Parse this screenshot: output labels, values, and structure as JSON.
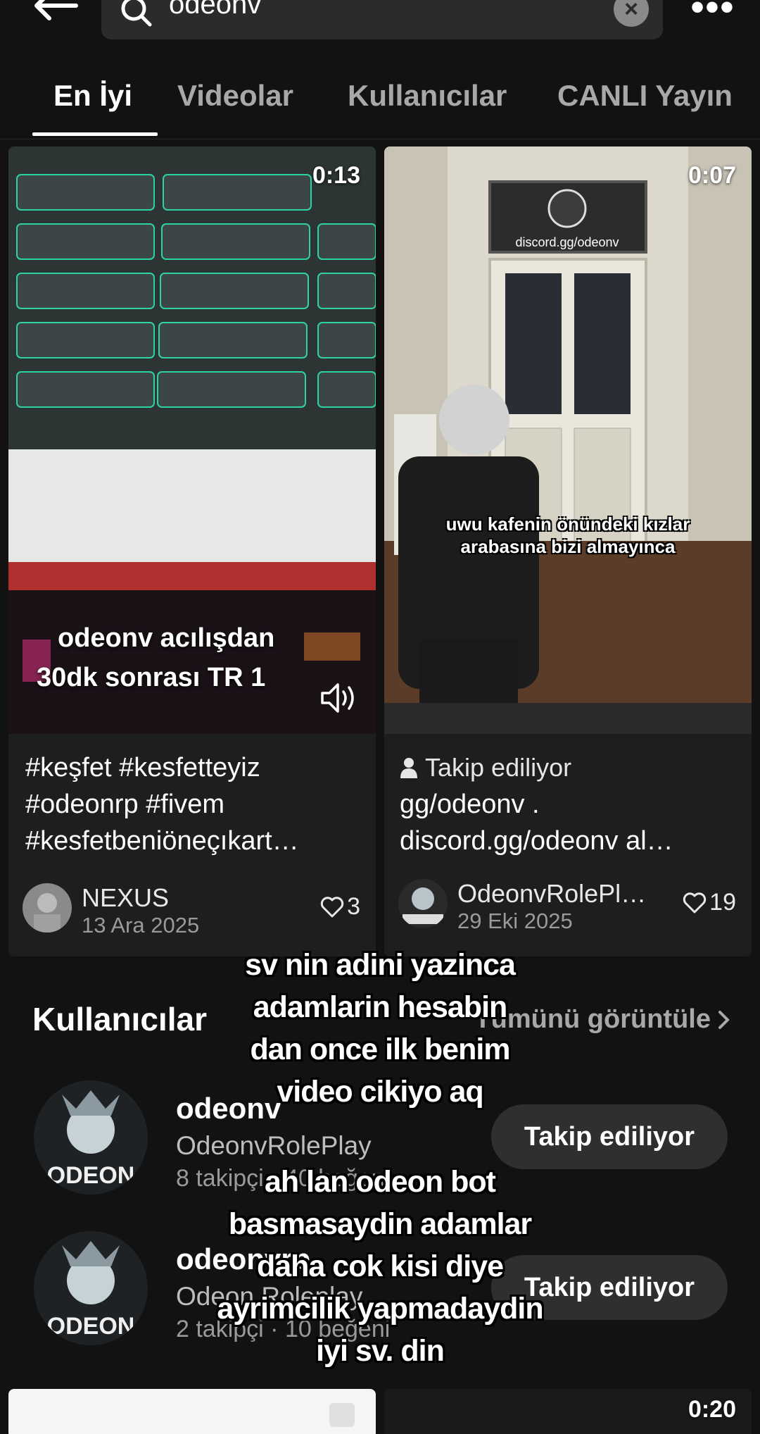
{
  "search": {
    "query": "odeonv",
    "clear_label": "×",
    "more_label": "•••"
  },
  "tabs": [
    {
      "label": "En İyi",
      "active": true
    },
    {
      "label": "Videolar",
      "active": false
    },
    {
      "label": "Kullanıcılar",
      "active": false
    },
    {
      "label": "CANLI Yayın",
      "active": false
    }
  ],
  "videos": [
    {
      "duration": "0:13",
      "overlay_text_1": "odeonv acılışdan",
      "overlay_text_2": "30dk sonrası TR 1",
      "caption_lines": [
        "#keşfet #kesfetteyiz",
        "#odeonrp #fivem",
        "#kesfetbeniöneçıkart…"
      ],
      "author": "NEXUS",
      "date": "13 Ara 2025",
      "likes": "3"
    },
    {
      "duration": "0:07",
      "door_sign": "discord.gg/odeonv",
      "subtitle_1": "uwu kafenin önündeki kızlar",
      "subtitle_2": "arabasına bizi almayınca",
      "following_tag": "Takip ediliyor",
      "caption_lines": [
        "gg/odeonv .",
        "discord.gg/odeonv al…"
      ],
      "author": "OdeonvRolePl…",
      "date": "29 Eki 2025",
      "likes": "19"
    }
  ],
  "users_section": {
    "title": "Kullanıcılar",
    "view_all": "Tümünü görüntüle",
    "users": [
      {
        "handle": "odeonv",
        "name": "OdeonvRolePlay",
        "stats": "8 takipçi · 40 beğeni",
        "button": "Takip ediliyor",
        "avatar_text": "ODEON"
      },
      {
        "handle": "odeonvrp",
        "name": "Odeon Roleplay",
        "stats": "2 takipçi · 10 beğeni",
        "button": "Takip ediliyor",
        "avatar_text": "ODEON"
      }
    ]
  },
  "overlay_comment": {
    "lines_1": [
      "sv nin adini yazinca",
      "adamlarin hesabin",
      "dan once ilk benim",
      "video cikiyo aq"
    ],
    "lines_2": [
      "ah lan odeon bot",
      "basmasaydin adamlar",
      "daha cok kisi diye",
      "ayrimcilik yapmadaydin",
      "iyi sv. din"
    ]
  },
  "bottom_cards": {
    "right_duration": "0:20"
  },
  "icons": {
    "back": "arrow-left-icon",
    "search": "search-icon",
    "sound": "speaker-icon",
    "heart": "heart-icon",
    "person": "person-icon",
    "chevron": "chevron-right-icon"
  },
  "colors": {
    "background": "#121212",
    "card": "#1e1e1e",
    "button": "#2f2f2f",
    "muted_text": "#a8a8a8"
  }
}
